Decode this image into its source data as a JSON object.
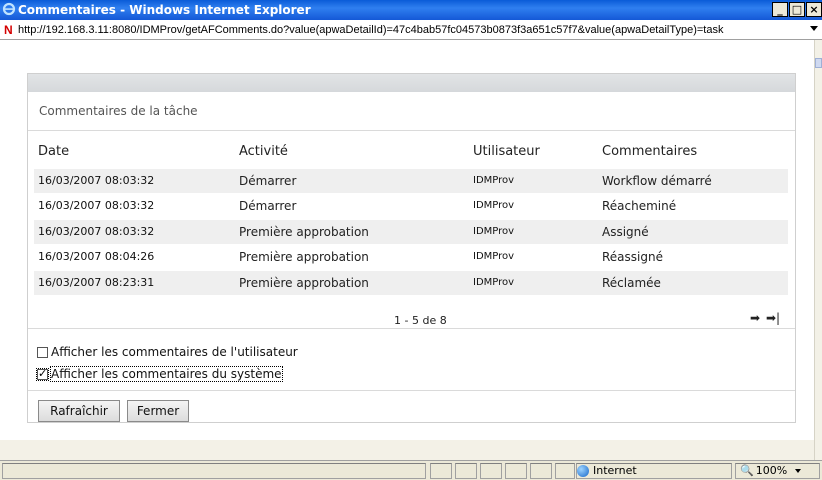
{
  "window": {
    "title": "Commentaires - Windows Internet Explorer",
    "buttons": [
      "_",
      "□",
      "×"
    ]
  },
  "address": {
    "icon": "N",
    "url": "http://192.168.3.11:8080/IDMProv/getAFComments.do?value(apwaDetailId)=47c4bab57fc04573b0873f3a651c57f7&value(apwaDetailType)=task"
  },
  "panel": {
    "title": "Commentaires de la tâche",
    "columns": [
      "Date",
      "Activité",
      "Utilisateur",
      "Commentaires"
    ],
    "rows": [
      {
        "date": "16/03/2007 08:03:32",
        "activity": "Démarrer",
        "user": "IDMProv",
        "comment": "Workflow démarré"
      },
      {
        "date": "16/03/2007 08:03:32",
        "activity": "Démarrer",
        "user": "IDMProv",
        "comment": "Réacheminé"
      },
      {
        "date": "16/03/2007 08:03:32",
        "activity": "Première approbation",
        "user": "IDMProv",
        "comment": "Assigné"
      },
      {
        "date": "16/03/2007 08:04:26",
        "activity": "Première approbation",
        "user": "IDMProv",
        "comment": "Réassigné"
      },
      {
        "date": "16/03/2007 08:23:31",
        "activity": "Première approbation",
        "user": "IDMProv",
        "comment": "Réclamée"
      }
    ],
    "pagination": "1 - 5 de 8",
    "nav": {
      "next": "➡",
      "last": "➡|"
    },
    "checkboxes": [
      {
        "label": "Afficher les commentaires de l'utilisateur",
        "checked": false
      },
      {
        "label": "Afficher les commentaires du système",
        "checked": true
      }
    ],
    "buttons": {
      "refresh": "Rafraîchir",
      "close": "Fermer"
    }
  },
  "status": {
    "zone": "Internet",
    "zoom": "100%"
  }
}
